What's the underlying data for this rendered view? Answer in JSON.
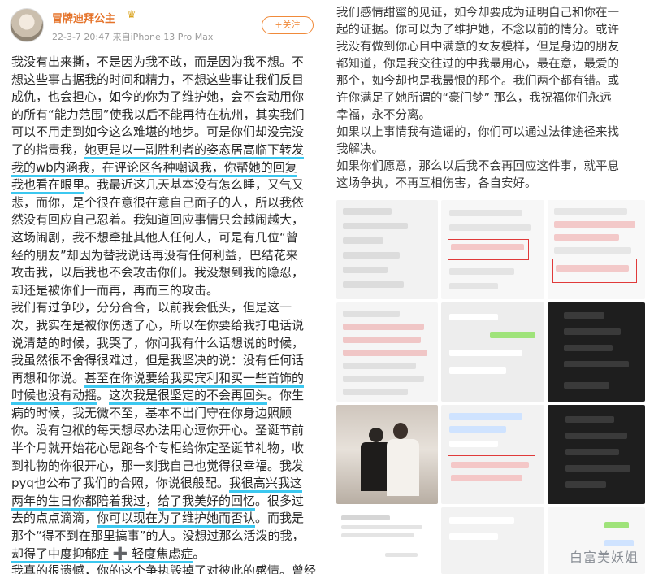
{
  "post": {
    "author": "冒牌迪拜公主",
    "meta": "22-3-7 20:47  来自iPhone 13 Pro Max",
    "follow_label": "+关注"
  },
  "left_lines": [
    [
      {
        "t": "我没有出来撕，不是因为我不敢，而是因为我不想。不"
      }
    ],
    [
      {
        "t": "想这些事占据我的时间和精力，不想这些事让我们反目"
      }
    ],
    [
      {
        "t": "成仇，也会担心，如今的你为了维护她，会不会动用你"
      }
    ],
    [
      {
        "t": "的所有“能力范围”使我以后不能再待在杭州，其实我们"
      }
    ],
    [
      {
        "t": "可以不用走到如今这么难堪的地步。可是你们却没完没"
      }
    ],
    [
      {
        "t": "了的指责我，"
      },
      {
        "t": "她更是以一副胜利者的姿态居高临下转发",
        "u": true
      }
    ],
    [
      {
        "t": "我的wb内涵我，在评论区各种嘲讽我，你帮她的回复",
        "u": true
      }
    ],
    [
      {
        "t": "我也看在眼里",
        "u": true
      },
      {
        "t": "。我最近这几天基本没有怎么睡，又气又"
      }
    ],
    [
      {
        "t": "悲，而你，是个很在意很在意自己面子的人，所以我依"
      }
    ],
    [
      {
        "t": "然没有回应自己忍着。我知道回应事情只会越闹越大，"
      }
    ],
    [
      {
        "t": "这场闹剧，我不想牵扯其他人任何人，可是有几位“曾"
      }
    ],
    [
      {
        "t": "经的朋友”却因为替我说话再没有任何利益，巴结花来"
      }
    ],
    [
      {
        "t": "攻击我，以后我也不会攻击你们。我没想到我的隐忍，"
      }
    ],
    [
      {
        "t": "却还是被你们一而再，再而三的攻击。"
      }
    ],
    [
      {
        "t": "我们有过争吵，分分合合，以前我会低头，但是这一"
      }
    ],
    [
      {
        "t": "次，我实在是被你伤透了心，所以在你要给我打电话说"
      }
    ],
    [
      {
        "t": "说清楚的时候，我哭了，你问我有什么话想说的时候，"
      }
    ],
    [
      {
        "t": "我虽然很不舍得很难过，但是我坚决的说：没有任何话"
      }
    ],
    [
      {
        "t": "再想和你说。"
      },
      {
        "t": "甚至在你说要给我买宾利和买一些首饰的",
        "u": true
      }
    ],
    [
      {
        "t": "时候也没有动摇",
        "u": true
      },
      {
        "t": "。"
      },
      {
        "t": "这次我是很坚定的不会再回头",
        "u": true
      },
      {
        "t": "。你生"
      }
    ],
    [
      {
        "t": "病的时候，我无微不至，基本不出门守在你身边照顾"
      }
    ],
    [
      {
        "t": "你。没有包袱的每天想尽办法用心逗你开心。圣诞节前"
      }
    ],
    [
      {
        "t": "半个月就开始花心思跑各个专柜给你定圣诞节礼物，收"
      }
    ],
    [
      {
        "t": "到礼物的你很开心，那一刻我自己也觉得很幸福。我发"
      }
    ],
    [
      {
        "t": "pyq也公布了我们的合照，你说很般配。"
      },
      {
        "t": "我很高兴我这",
        "u": true
      }
    ],
    [
      {
        "t": "两年的生日你都陪着我过",
        "u": true
      },
      {
        "t": "，"
      },
      {
        "t": "给了我美好的回忆",
        "u": true
      },
      {
        "t": "。很多过"
      }
    ],
    [
      {
        "t": "去的点点滴滴，"
      },
      {
        "t": "你可以现在为了维护她而否认",
        "u": true
      },
      {
        "t": "。而我是"
      }
    ],
    [
      {
        "t": "那个“得不到在那里搞事”的人。没想过那么活泼的我，"
      }
    ],
    [
      {
        "t": "却得了中度抑郁症 ➕ 轻度焦虑症",
        "u": true
      },
      {
        "t": "。"
      }
    ],
    [
      {
        "t": "我真的很遗憾，你的这个争执毁掉了对彼此的感情。曾经"
      }
    ]
  ],
  "right_lines": [
    "我们感情甜蜜的见证，如今却要成为证明自己和你在一",
    "起的证据。你可以为了维护她，不念以前的情分。或许",
    "我没有做到你心目中满意的女友模样，但是身边的朋友",
    "都知道，你是我交往过的中我最用心，最在意，最爱的",
    "那个，如今却也是我最恨的那个。我们两个都有错。或",
    "许你满足了她所谓的“豪门梦” 那么，我祝福你们永远",
    "幸福，永不分离。",
    "如果以上事情我有造谣的，你们可以通过法律途径来找",
    "我解决。",
    "如果你们愿意，那么以后我不会再回应这件事，就平息",
    "这场争执，不再互相伤害，各自安好。"
  ],
  "watermark": "白富美妖姐",
  "colors": {
    "underline": "#3cc8f0",
    "author": "#e5732a",
    "follow": "#f08a3a"
  }
}
